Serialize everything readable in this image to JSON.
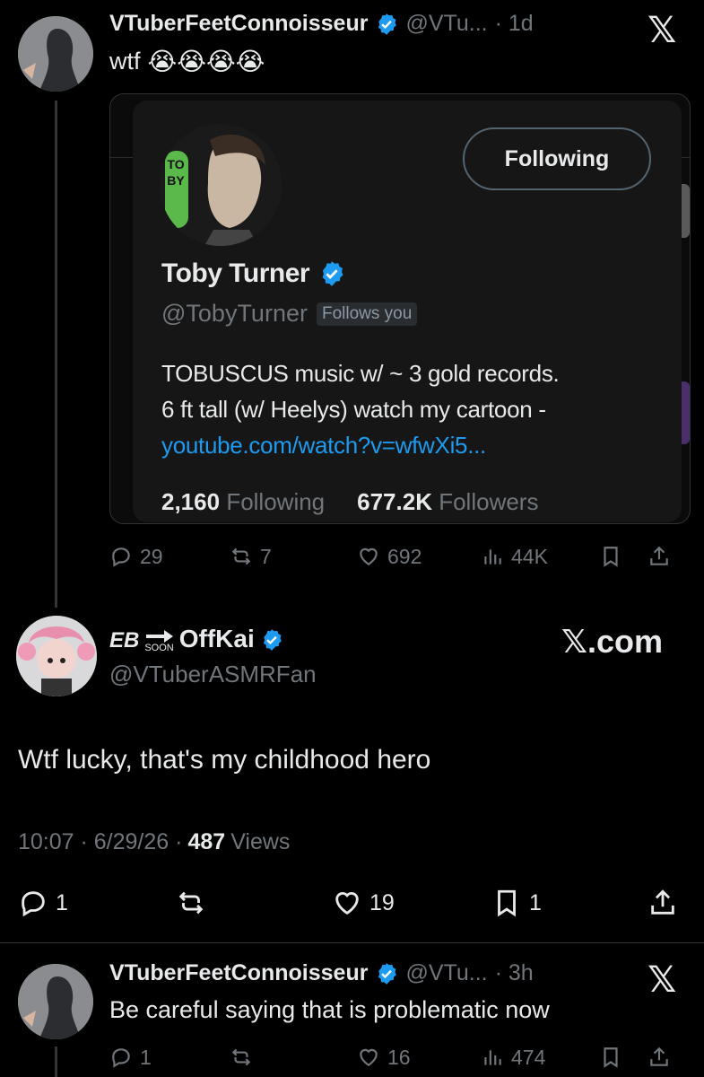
{
  "tweet1": {
    "name": "VTuberFeetConnoisseur",
    "handle": "@VTu...",
    "time": "· 1d",
    "text": "wtf",
    "emojis": "😭😭😭😭",
    "actions": {
      "replies": "29",
      "retweets": "7",
      "likes": "692",
      "views": "44K"
    }
  },
  "card": {
    "follow_button": "Following",
    "name": "Toby Turner",
    "handle": "@TobyTurner",
    "follows_you": "Follows you",
    "bio_line1": "TOBUSCUS music w/ ~ 3 gold records.",
    "bio_line2": "6 ft tall (w/ Heelys) watch my cartoon -",
    "bio_link": "youtube.com/watch?v=wfwXi5...",
    "following_count": "2,160",
    "following_label": "Following",
    "followers_count": "677.2K",
    "followers_label": "Followers",
    "avatar_text": "TOBY"
  },
  "main_tweet": {
    "name_prefix": "EB",
    "soon": "SOON",
    "name_suffix": "OffKai",
    "handle": "@VTuberASMRFan",
    "brand": "𝕏.com",
    "text": "Wtf lucky, that's my childhood hero",
    "meta_time": "10:07 · 6/29/26 ·",
    "views_count": "487",
    "views_label": "Views",
    "actions": {
      "replies": "1",
      "retweets": "",
      "likes": "19",
      "bookmarks": "1"
    }
  },
  "tweet3": {
    "name": "VTuberFeetConnoisseur",
    "handle": "@VTu...",
    "time": "· 3h",
    "text": "Be careful saying that is problematic now",
    "actions": {
      "replies": "1",
      "retweets": "",
      "likes": "16",
      "views": "474"
    }
  },
  "colors": {
    "accent": "#1d9bf0",
    "muted": "#71767b",
    "background": "#000000"
  }
}
